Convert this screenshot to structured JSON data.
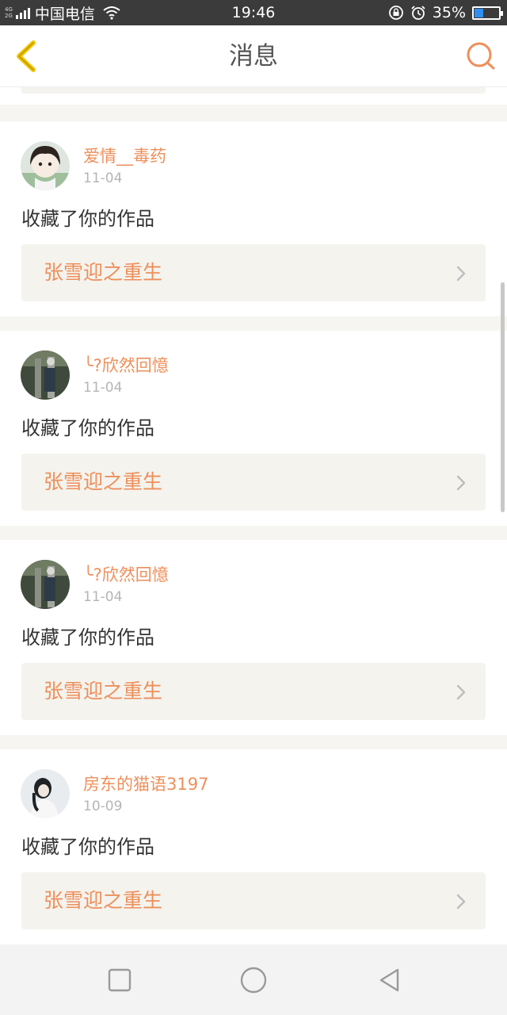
{
  "status_bar": {
    "net_tags": [
      "4G",
      "2G"
    ],
    "carrier": "中国电信",
    "time": "19:46",
    "battery_percent": "35%",
    "battery_level": 0.35
  },
  "header": {
    "title": "消息",
    "back_icon": "chevron-left-icon",
    "search_icon": "search-icon"
  },
  "colors": {
    "accent": "#ee8f5a",
    "back_icon": "#f2c400",
    "card_bg": "#ffffff",
    "page_bg": "#f6f5f2",
    "work_box_bg": "#f4f3ee"
  },
  "notifications": [
    {
      "username": "爱情__毒药",
      "date": "11-04",
      "action": "收藏了你的作品",
      "work_title": "张雪迎之重生"
    },
    {
      "username": "╰?欣然回憶",
      "date": "11-04",
      "action": "收藏了你的作品",
      "work_title": "张雪迎之重生"
    },
    {
      "username": "╰?欣然回憶",
      "date": "11-04",
      "action": "收藏了你的作品",
      "work_title": "张雪迎之重生"
    },
    {
      "username": "房东的猫语3197",
      "date": "10-09",
      "action": "收藏了你的作品",
      "work_title": "张雪迎之重生"
    }
  ],
  "nav_bar": {
    "recents_icon": "square-icon",
    "home_icon": "circle-icon",
    "back_icon": "triangle-back-icon"
  }
}
